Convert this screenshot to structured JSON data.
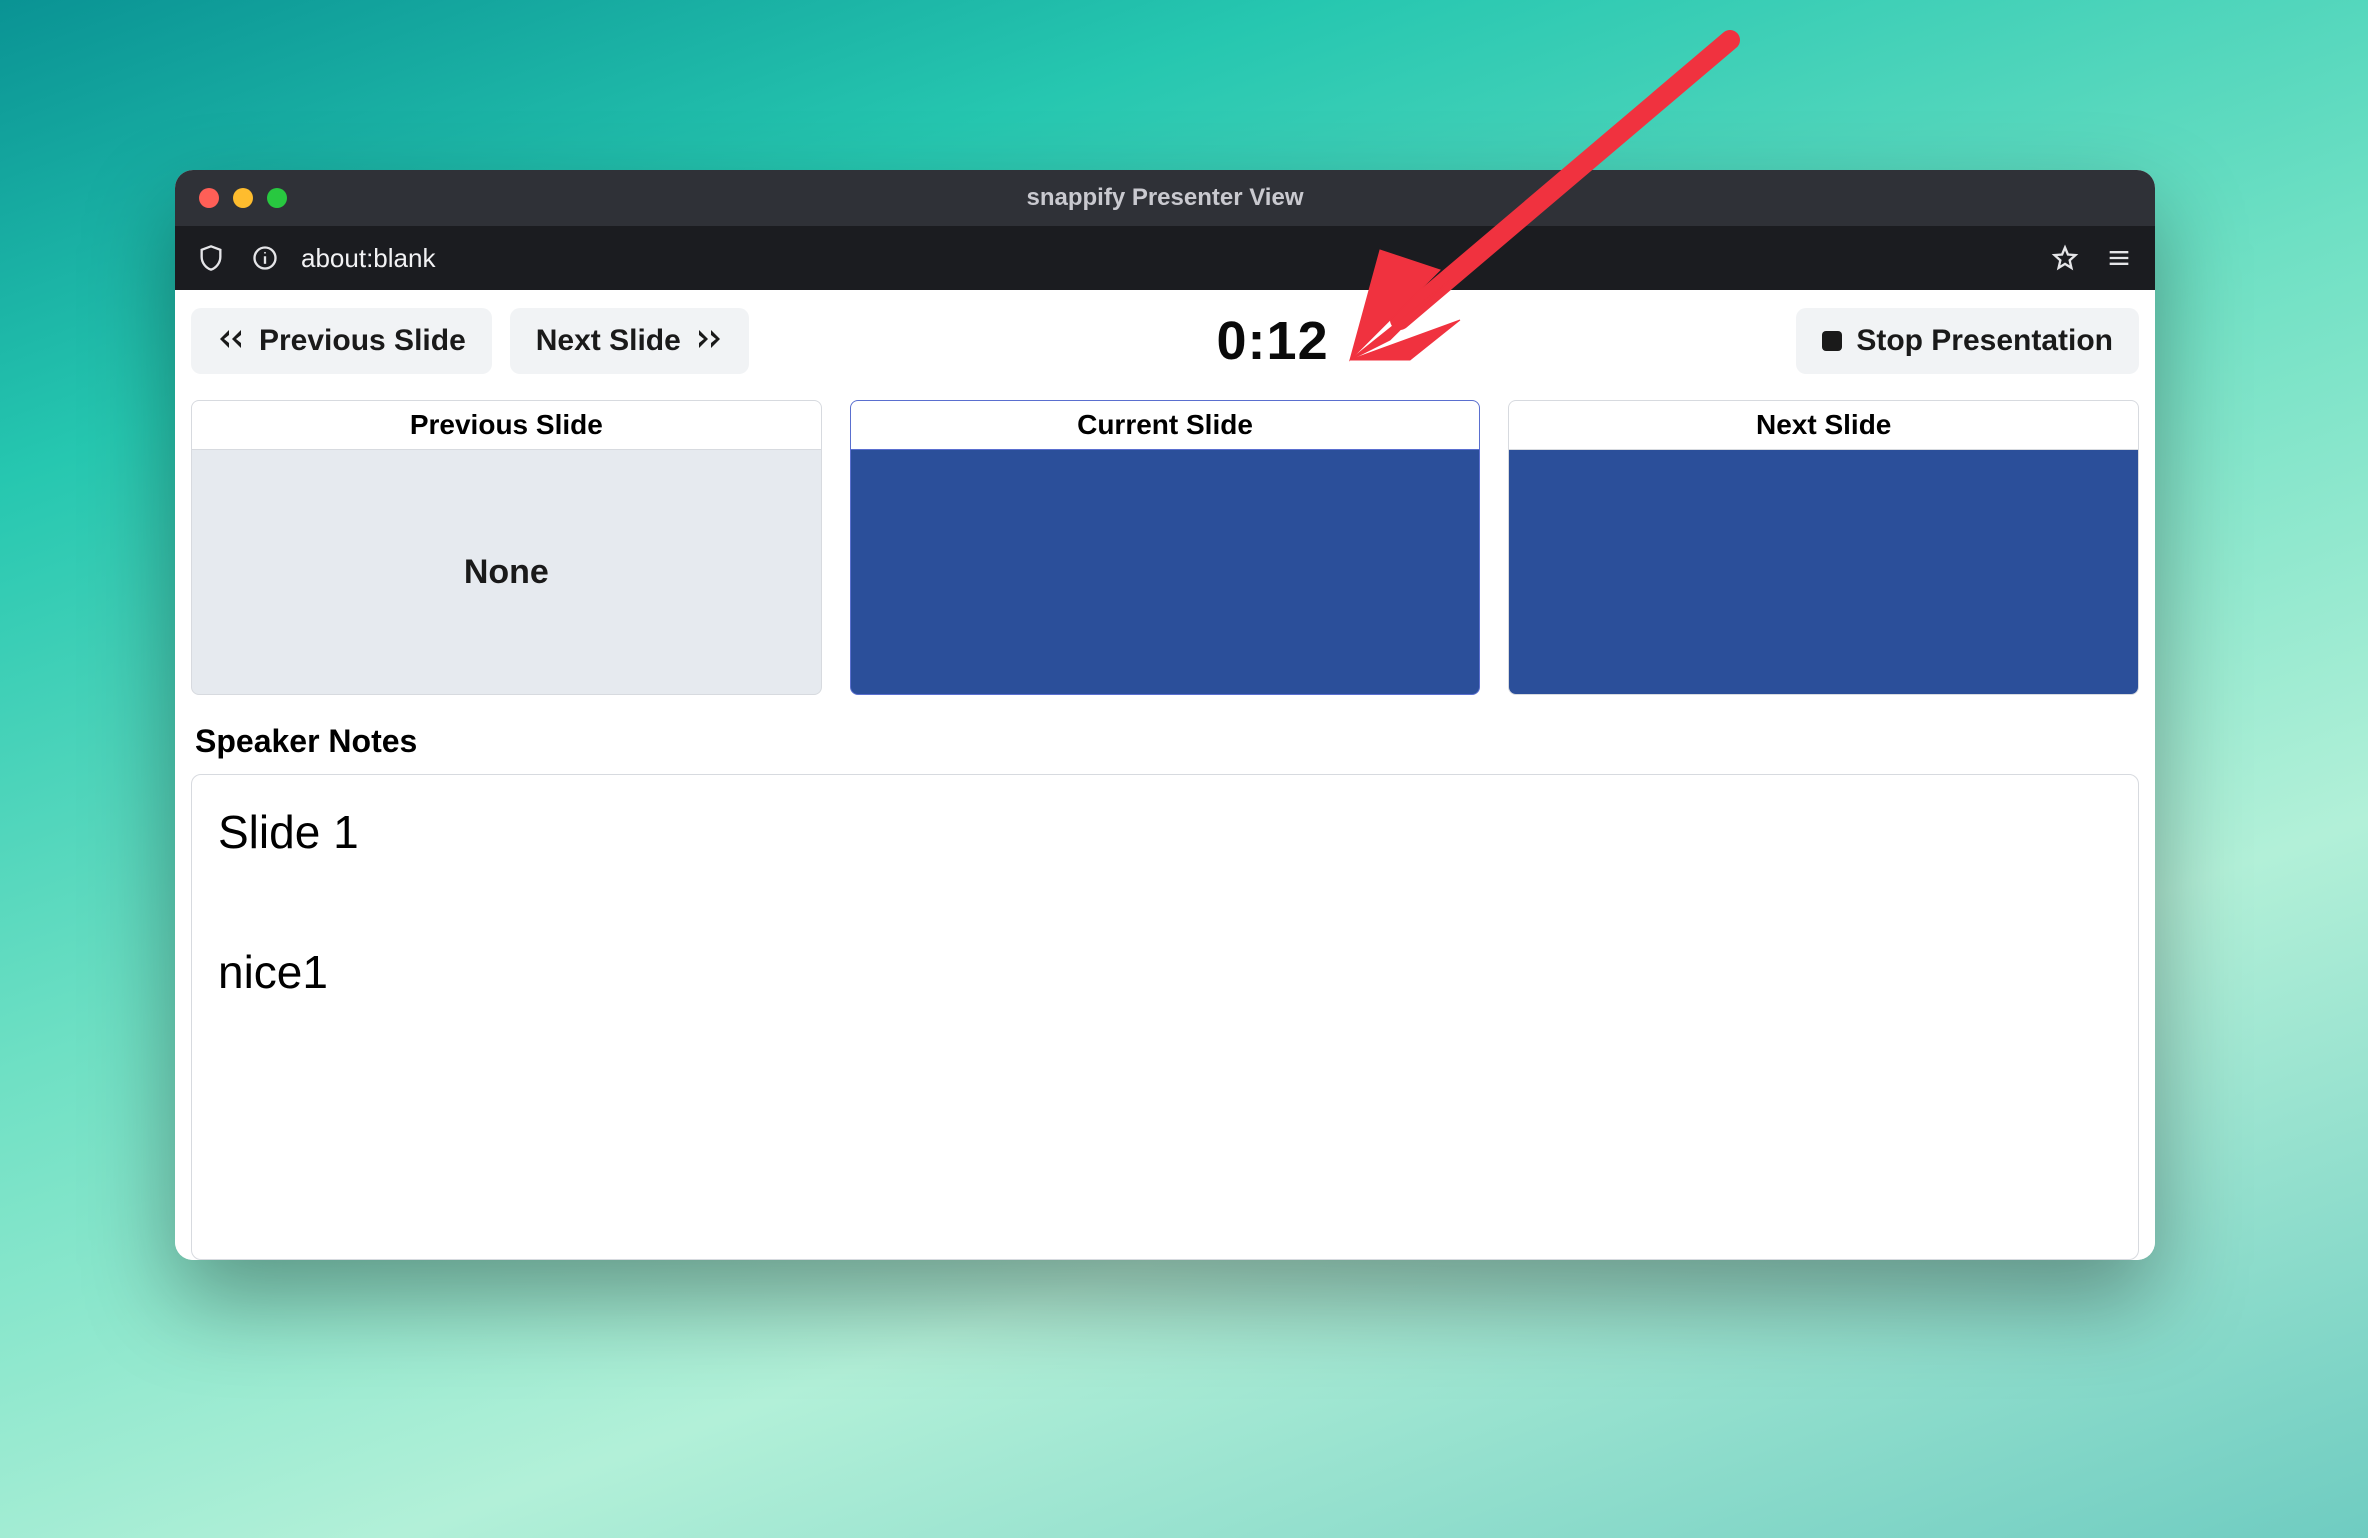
{
  "browser": {
    "window_title": "snappify Presenter View",
    "url": "about:blank"
  },
  "controls": {
    "previous_label": "Previous Slide",
    "next_label": "Next Slide",
    "stop_label": "Stop Presentation"
  },
  "timer": {
    "value": "0:12"
  },
  "slides": {
    "previous": {
      "header": "Previous Slide",
      "body": "None"
    },
    "current": {
      "header": "Current Slide"
    },
    "next": {
      "header": "Next Slide"
    }
  },
  "notes": {
    "title": "Speaker Notes",
    "lines": [
      "Slide 1",
      "nice1"
    ]
  },
  "annotation": {
    "color": "#f0323f"
  }
}
